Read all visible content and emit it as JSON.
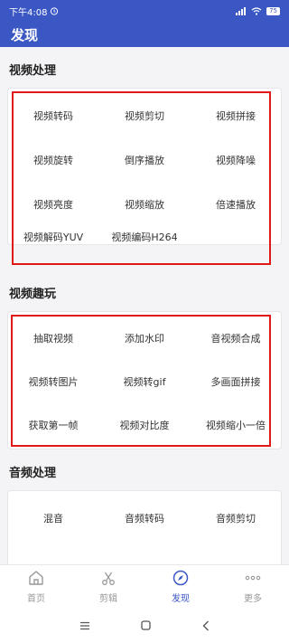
{
  "status": {
    "time": "下午4:08",
    "battery": "75"
  },
  "header": {
    "title": "发现"
  },
  "sections": {
    "video_processing": {
      "title": "视频处理",
      "items": [
        "视频转码",
        "视频剪切",
        "视频拼接",
        "视频旋转",
        "倒序播放",
        "视频降噪",
        "视频亮度",
        "视频缩放",
        "倍速播放",
        "视频解码YUV",
        "视频编码H264"
      ]
    },
    "video_fun": {
      "title": "视频趣玩",
      "items": [
        "抽取视频",
        "添加水印",
        "音视频合成",
        "视频转图片",
        "视频转gif",
        "多画面拼接",
        "获取第一帧",
        "视频对比度",
        "视频缩小一倍"
      ]
    },
    "audio_processing": {
      "title": "音频处理",
      "items": [
        "混音",
        "音频转码",
        "音频剪切"
      ]
    }
  },
  "bottom_nav": [
    {
      "label": "首页",
      "icon": "home-icon",
      "active": false
    },
    {
      "label": "剪辑",
      "icon": "scissors-icon",
      "active": false
    },
    {
      "label": "发现",
      "icon": "compass-icon",
      "active": true
    },
    {
      "label": "更多",
      "icon": "more-dots-icon",
      "active": false
    }
  ],
  "colors": {
    "primary": "#3a57c4",
    "highlight": "#e01818",
    "inactive": "#999999"
  }
}
